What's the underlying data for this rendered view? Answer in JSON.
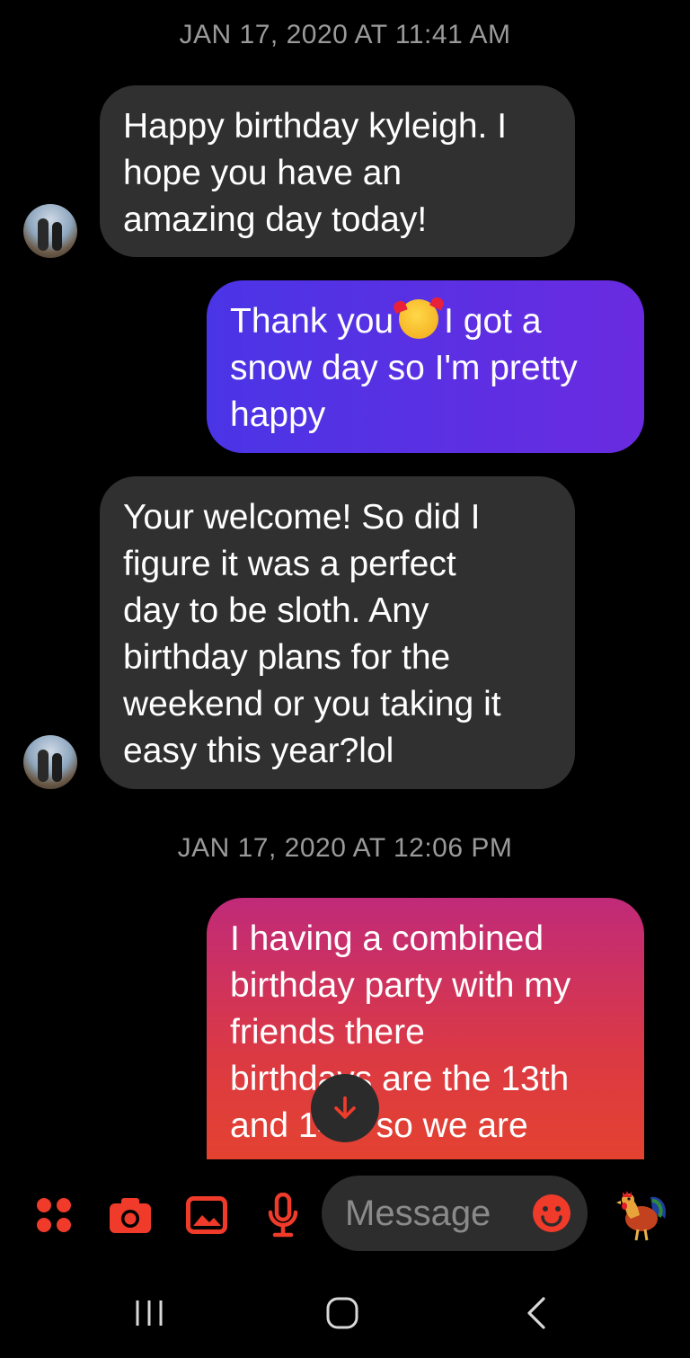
{
  "conversation": {
    "timestamps": [
      "JAN 17, 2020 AT 11:41 AM",
      "JAN 17, 2020 AT 12:06 PM"
    ],
    "messages": [
      {
        "direction": "received",
        "lines": [
          "Happy birthday kyleigh. I",
          "hope you have an",
          "amazing day today!"
        ]
      },
      {
        "direction": "sent",
        "line1_before": "Thank you",
        "line1_emoji": "smiling-face-with-hearts-emoji",
        "line1_after": "I got a",
        "lines_rest": [
          "snow day so I'm pretty",
          "happy"
        ]
      },
      {
        "direction": "received",
        "lines": [
          "Your welcome! So did I",
          "figure it was a perfect",
          "day to be sloth. Any",
          "birthday plans for the",
          "weekend or you taking it",
          "easy this year?lol"
        ]
      },
      {
        "direction": "sent",
        "lines": [
          "I having a combined",
          "birthday party with my",
          "friends there",
          "birthdays are the 13th",
          "and 14th so we are"
        ]
      }
    ]
  },
  "composer": {
    "placeholder": "Message",
    "icons": [
      "apps-icon",
      "camera-icon",
      "gallery-icon",
      "microphone-icon",
      "emoji-icon",
      "rooster-sticker-icon"
    ],
    "accent_color": "#f03b2b"
  },
  "navigation": {
    "icons": [
      "recent-apps-icon",
      "home-icon",
      "back-icon"
    ]
  },
  "colors": {
    "background": "#000000",
    "received_bubble": "#303030",
    "sent_bubble_1": "#5330e6",
    "sent_bubble_2": "#dc3a42"
  }
}
